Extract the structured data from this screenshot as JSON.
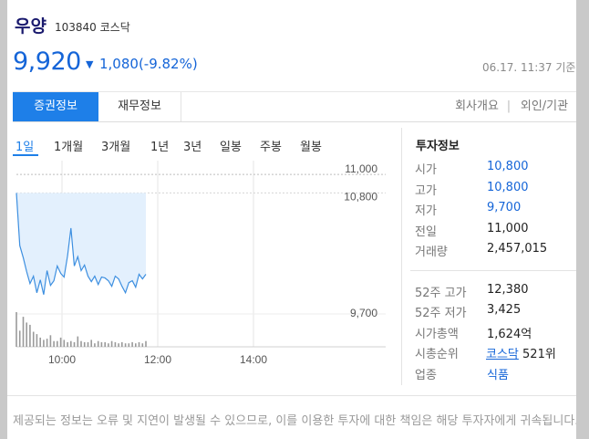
{
  "stock": {
    "name": "우양",
    "code": "103840",
    "market": "코스닥",
    "price": "9,920",
    "change_arrow": "▼",
    "change": "1,080(-9.82%)",
    "timestamp": "06.17. 11:37 기준"
  },
  "tabs": [
    {
      "label": "증권정보",
      "active": true
    },
    {
      "label": "재무정보",
      "active": false
    }
  ],
  "links": {
    "company": "회사개요",
    "divider": "|",
    "foreign": "외인/기관"
  },
  "ranges": [
    {
      "label": "1일",
      "active": true
    },
    {
      "label": "1개월",
      "active": false
    },
    {
      "label": "3개월",
      "active": false
    },
    {
      "label": "1년",
      "active": false
    },
    {
      "label": "3년",
      "active": false
    },
    {
      "label": "일봉",
      "active": false
    },
    {
      "label": "주봉",
      "active": false
    },
    {
      "label": "월봉",
      "active": false
    }
  ],
  "chart_data": {
    "type": "line",
    "series": [
      {
        "values": [
          10800,
          10230,
          10100,
          9950,
          9820,
          9900,
          9720,
          9860,
          9700,
          9960,
          9800,
          9850,
          10010,
          9930,
          9890,
          10120,
          10420,
          10010,
          10110,
          9960,
          10020,
          9900,
          9840,
          9900,
          9810,
          9890,
          9880,
          9850,
          9790,
          9900,
          9870,
          9790,
          9720,
          9830,
          9850,
          9780,
          9920,
          9870,
          9920
        ]
      }
    ],
    "reference_lines": {
      "prev_close": 11000,
      "high": 10800,
      "low": 9700
    },
    "y_tick_labels": [
      "11,000",
      "10,800",
      "9,700"
    ],
    "x_tick_labels": [
      "10:00",
      "12:00",
      "14:00"
    ],
    "ylim": [
      9570,
      11100
    ],
    "volume": [
      30,
      14,
      26,
      21,
      19,
      13,
      11,
      8,
      6,
      7,
      10,
      5,
      5,
      8,
      6,
      4,
      5,
      4,
      9,
      5,
      4,
      4,
      6,
      3,
      5,
      4,
      4,
      3,
      5,
      4,
      3,
      4,
      3,
      3,
      4,
      3,
      4,
      3,
      5
    ]
  },
  "investment_info": {
    "title": "투자정보",
    "rows": [
      {
        "label": "시가",
        "value": "10,800",
        "color": "#1565d8"
      },
      {
        "label": "고가",
        "value": "10,800",
        "color": "#1565d8"
      },
      {
        "label": "저가",
        "value": "9,700",
        "color": "#1565d8"
      },
      {
        "label": "전일",
        "value": "11,000",
        "color": "#222222"
      },
      {
        "label": "거래량",
        "value": "2,457,015",
        "color": "#222222"
      }
    ],
    "rows2": [
      {
        "label": "52주 고가",
        "value": "12,380"
      },
      {
        "label": "52주 저가",
        "value": "3,425"
      },
      {
        "label": "시가총액",
        "value": "1,624억"
      }
    ],
    "rank": {
      "label": "시총순위",
      "market_link": "코스닥",
      "rank": "521위"
    },
    "sector": {
      "label": "업종",
      "value": "식품"
    }
  },
  "footer": {
    "text": "제공되는 정보는 오류 및 지연이 발생될 수 있으므로, 이를 이용한 투자에 대한 책임은 해당 투자자에게 귀속됩니다."
  },
  "colors": {
    "accent": "#1e7fe8",
    "down": "#1565d8"
  }
}
